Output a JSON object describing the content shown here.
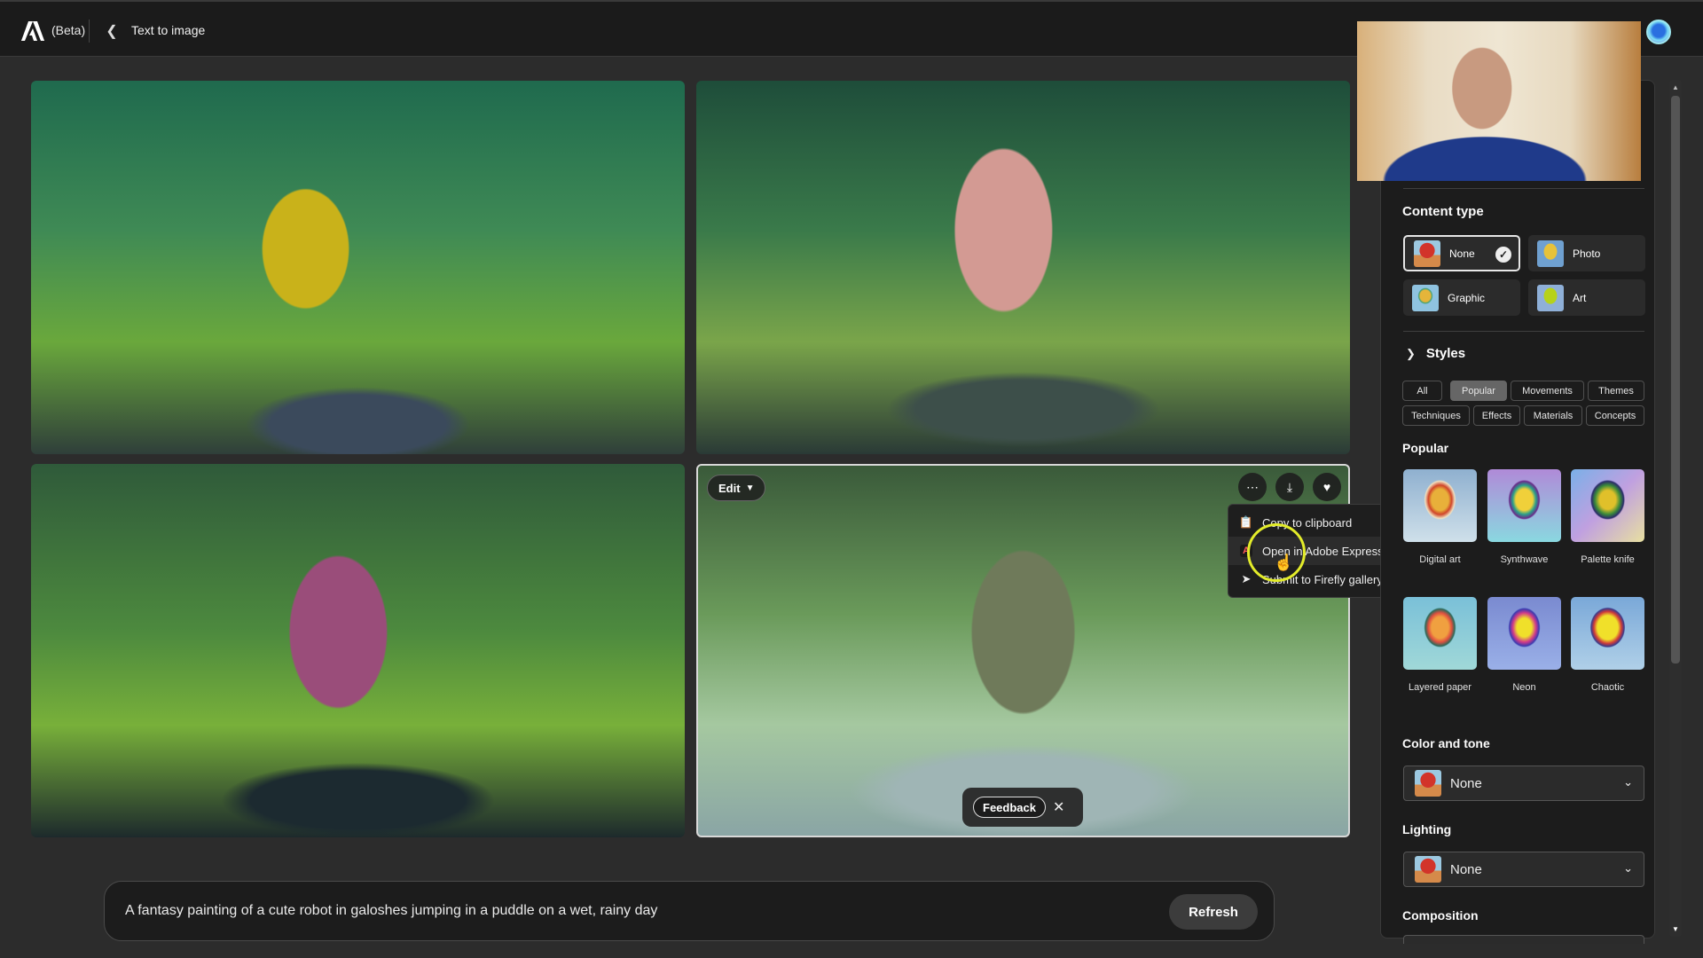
{
  "topbar": {
    "brand": "Adobe",
    "beta_label": "(Beta)",
    "page_title": "Text to image"
  },
  "gallery": {
    "images": [
      {
        "description": "Yellow robot jumping in a puddle in the rain"
      },
      {
        "description": "Pink robot running through a puddle in the rain"
      },
      {
        "description": "Purple robot splashing in a puddle in the rain"
      },
      {
        "description": "Olive-green robot with antenna splashing in a puddle",
        "selected": true
      }
    ],
    "edit_label": "Edit",
    "actions": {
      "more_icon": "more-icon",
      "download_icon": "download-icon",
      "favorite_icon": "heart-icon"
    },
    "context_menu": [
      {
        "label": "Copy to clipboard",
        "icon": "clipboard-icon"
      },
      {
        "label": "Open in Adobe Express",
        "icon": "adobe-express-icon"
      },
      {
        "label": "Submit to Firefly gallery",
        "icon": "send-icon"
      }
    ],
    "feedback_label": "Feedback"
  },
  "prompt": {
    "text": "A fantasy painting of a cute robot in galoshes jumping in a puddle on a wet, rainy day",
    "refresh_label": "Refresh"
  },
  "panel": {
    "content_type": {
      "title": "Content type",
      "options": [
        {
          "label": "None",
          "selected": true
        },
        {
          "label": "Photo",
          "selected": false
        },
        {
          "label": "Graphic",
          "selected": false
        },
        {
          "label": "Art",
          "selected": false
        }
      ]
    },
    "styles": {
      "title": "Styles",
      "filters": [
        {
          "label": "All",
          "active": false
        },
        {
          "label": "Popular",
          "active": true
        },
        {
          "label": "Movements",
          "active": false
        },
        {
          "label": "Themes",
          "active": false
        },
        {
          "label": "Techniques",
          "active": false
        },
        {
          "label": "Effects",
          "active": false
        },
        {
          "label": "Materials",
          "active": false
        },
        {
          "label": "Concepts",
          "active": false
        }
      ],
      "group_title": "Popular",
      "items": [
        {
          "label": "Digital art"
        },
        {
          "label": "Synthwave"
        },
        {
          "label": "Palette knife"
        },
        {
          "label": "Layered paper"
        },
        {
          "label": "Neon"
        },
        {
          "label": "Chaotic"
        }
      ]
    },
    "color_and_tone": {
      "title": "Color and tone",
      "value": "None"
    },
    "lighting": {
      "title": "Lighting",
      "value": "None"
    },
    "composition": {
      "title": "Composition"
    }
  }
}
